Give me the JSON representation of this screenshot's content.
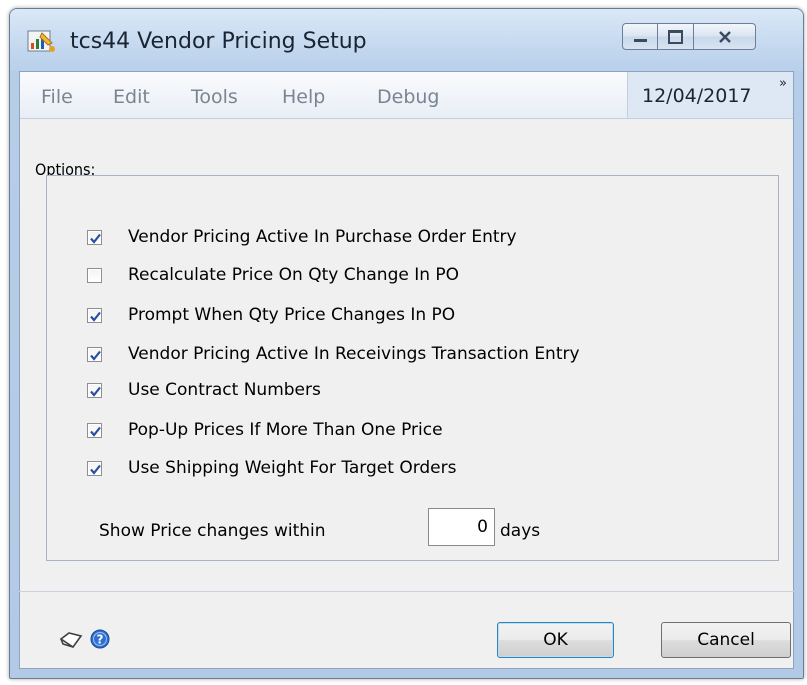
{
  "window": {
    "title": "tcs44 Vendor Pricing Setup",
    "icon": "app-report-icon"
  },
  "caption_buttons": [
    "minimize-icon",
    "maximize-icon",
    "close-icon"
  ],
  "menu": {
    "items": [
      "File",
      "Edit",
      "Tools",
      "Help",
      "Debug"
    ],
    "date": "12/04/2017",
    "chevron": "»"
  },
  "options": {
    "heading": "Options:",
    "checkboxes": [
      {
        "label": "Vendor Pricing Active In Purchase Order Entry",
        "checked": true
      },
      {
        "label": "Recalculate Price On Qty Change In PO",
        "checked": false
      },
      {
        "label": "Prompt When Qty Price Changes In PO",
        "checked": true
      },
      {
        "label": "Vendor Pricing Active In Receivings Transaction Entry",
        "checked": true
      },
      {
        "label": "Use Contract Numbers",
        "checked": true
      },
      {
        "label": "Pop-Up Prices If More Than One Price",
        "checked": true
      },
      {
        "label": "Use Shipping Weight For Target Orders",
        "checked": true
      }
    ],
    "price_changes": {
      "label": "Show Price changes within",
      "value": "0",
      "unit": "days"
    }
  },
  "footer": {
    "note_icon": "note-icon",
    "help_icon": "help-icon",
    "ok_label": "OK",
    "cancel_label": "Cancel"
  },
  "colors": {
    "window_frame": "#b6cde8",
    "client_background": "#f0f0f0",
    "checkmark": "#2a4f9e",
    "help_icon": "#2f6fd0"
  }
}
